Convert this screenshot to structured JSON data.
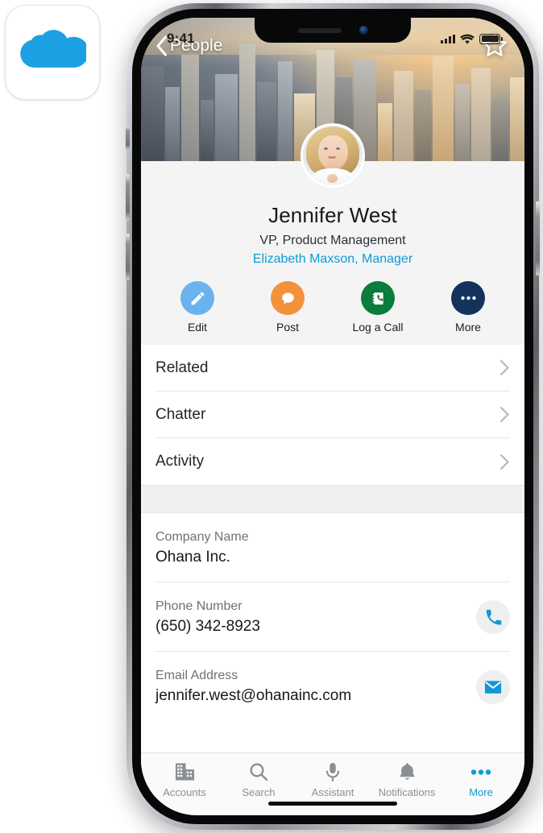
{
  "app_icon": {
    "name": "salesforce-cloud-logo",
    "color": "#1ba0e3"
  },
  "status_bar": {
    "time": "9:41",
    "signal_icon": "cellular-signal-icon",
    "wifi_icon": "wifi-icon",
    "battery_icon": "battery-full-icon"
  },
  "banner": {
    "back_label": "People",
    "back_icon": "chevron-left-icon",
    "favorite_icon": "star-outline-icon",
    "image_name": "san-francisco-skyline-banner"
  },
  "profile": {
    "avatar_name": "contact-avatar",
    "name": "Jennifer West",
    "title": "VP, Product Management",
    "manager": "Elizabeth Maxson, Manager",
    "manager_color": "#0d9bdb"
  },
  "actions": [
    {
      "label": "Edit",
      "icon": "pencil-icon",
      "color": "#6ab3ef"
    },
    {
      "label": "Post",
      "icon": "chat-bubble-icon",
      "color": "#f3923c"
    },
    {
      "label": "Log a Call",
      "icon": "call-log-icon",
      "color": "#0b7b3e"
    },
    {
      "label": "More",
      "icon": "ellipsis-icon",
      "color": "#14325c"
    }
  ],
  "nav_rows": [
    {
      "label": "Related",
      "chevron": "chevron-right-icon"
    },
    {
      "label": "Chatter",
      "chevron": "chevron-right-icon"
    },
    {
      "label": "Activity",
      "chevron": "chevron-right-icon"
    }
  ],
  "fields": [
    {
      "label": "Company Name",
      "value": "Ohana Inc.",
      "action_icon": ""
    },
    {
      "label": "Phone Number",
      "value": "(650) 342-8923",
      "action_icon": "phone-icon"
    },
    {
      "label": "Email Address",
      "value": "jennifer.west@ohanainc.com",
      "action_icon": "envelope-icon"
    }
  ],
  "tabbar": {
    "items": [
      {
        "label": "Accounts",
        "icon": "buildings-icon",
        "active": false
      },
      {
        "label": "Search",
        "icon": "magnifier-icon",
        "active": false
      },
      {
        "label": "Assistant",
        "icon": "microphone-icon",
        "active": false
      },
      {
        "label": "Notifications",
        "icon": "bell-icon",
        "active": false
      },
      {
        "label": "More",
        "icon": "ellipsis-icon",
        "active": true
      }
    ],
    "active_color": "#0d9bdb",
    "inactive_color": "#8a8f94"
  }
}
